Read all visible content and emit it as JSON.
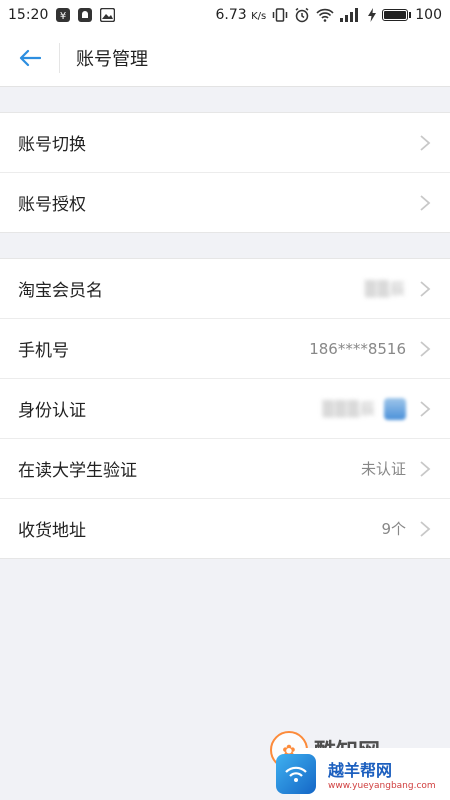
{
  "status_bar": {
    "time": "15:20",
    "speed": "6.73",
    "speed_unit": "K/s",
    "battery": "100",
    "battery_level_pct": 100
  },
  "header": {
    "title": "账号管理"
  },
  "group1": [
    {
      "label": "账号切换",
      "value": ""
    },
    {
      "label": "账号授权",
      "value": ""
    }
  ],
  "group2": [
    {
      "label": "淘宝会员名",
      "value": "辰"
    },
    {
      "label": "手机号",
      "value": "186****8516"
    },
    {
      "label": "身份认证",
      "value": "辰"
    },
    {
      "label": "在读大学生验证",
      "value": "未认证"
    },
    {
      "label": "收货地址",
      "value": "9个"
    }
  ],
  "watermark": {
    "brand": "酷知网",
    "site_title": "越羊帮网",
    "site_url": "www.yueyangbang.com"
  },
  "colors": {
    "accent": "#2d8ee0",
    "background": "#f1f2f6",
    "chevron": "#c8c8c8"
  },
  "icons": {
    "back": "arrow-left-icon",
    "chevron": "chevron-right-icon"
  }
}
